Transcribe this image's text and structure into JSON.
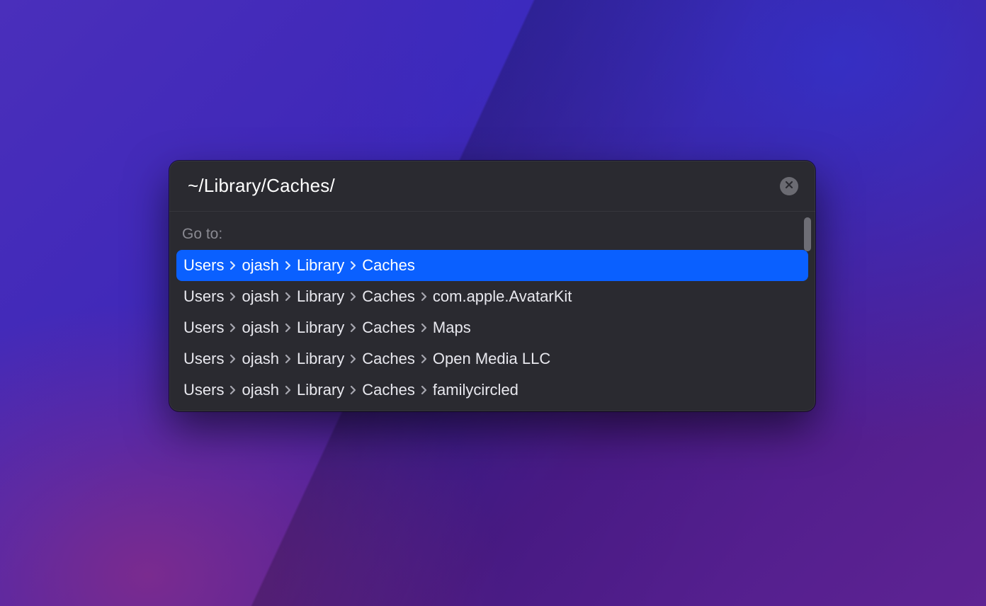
{
  "dialog": {
    "input_value": "~/Library/Caches/",
    "section_label": "Go to:",
    "results": [
      {
        "segments": [
          "Users",
          "ojash",
          "Library",
          "Caches"
        ],
        "selected": true
      },
      {
        "segments": [
          "Users",
          "ojash",
          "Library",
          "Caches",
          "com.apple.AvatarKit"
        ],
        "selected": false
      },
      {
        "segments": [
          "Users",
          "ojash",
          "Library",
          "Caches",
          "Maps"
        ],
        "selected": false
      },
      {
        "segments": [
          "Users",
          "ojash",
          "Library",
          "Caches",
          "Open Media LLC"
        ],
        "selected": false
      },
      {
        "segments": [
          "Users",
          "ojash",
          "Library",
          "Caches",
          "familycircled"
        ],
        "selected": false
      }
    ]
  },
  "colors": {
    "selection": "#0a60ff",
    "panel": "#2a2a30"
  }
}
